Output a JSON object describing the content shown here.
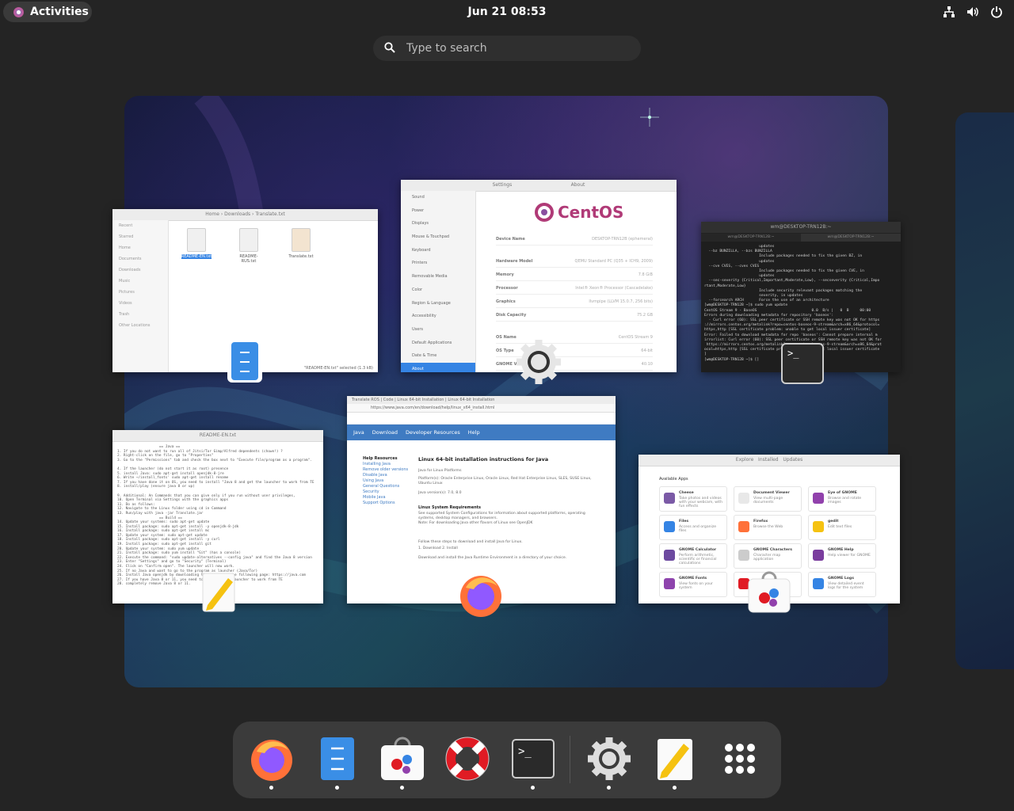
{
  "topbar": {
    "activities_label": "Activities",
    "clock": "Jun 21  08:53",
    "tray_icons": [
      "network-wired-icon",
      "volume-icon",
      "power-icon"
    ]
  },
  "search": {
    "placeholder": "Type to search"
  },
  "windows": {
    "files": {
      "sidebar": [
        "Recent",
        "Starred",
        "Home",
        "Documents",
        "Downloads",
        "Music",
        "Pictures",
        "Videos",
        "Trash",
        "Other Locations"
      ],
      "files": [
        "README-EN.txt",
        "README-RUS.txt",
        "Translate.txt"
      ],
      "breadcrumbs": [
        "Home",
        "Downloads",
        "Translate.txt"
      ],
      "status": "\"README-EN.txt\" selected (1.3 kB)"
    },
    "settings": {
      "title": "Settings",
      "panel_title": "About",
      "sidebar": [
        "Sound",
        "Power",
        "Displays",
        "Mouse & Touchpad",
        "Keyboard",
        "Printers",
        "Removable Media",
        "Color",
        "Region & Language",
        "Accessibility",
        "Users",
        "Default Applications",
        "Date & Time",
        "About"
      ],
      "logo_text": "CentOS",
      "rows": [
        {
          "label": "Device Name",
          "value": "DESKTOP-TRN12B (ephemeral)"
        },
        {
          "label": "Hardware Model",
          "value": "QEMU Standard PC (Q35 + ICH9, 2009)"
        },
        {
          "label": "Memory",
          "value": "7.8 GiB"
        },
        {
          "label": "Processor",
          "value": "Intel® Xeon® Processor (Cascadelake)"
        },
        {
          "label": "Graphics",
          "value": "llvmpipe (LLVM 15.0.7, 256 bits)"
        },
        {
          "label": "Disk Capacity",
          "value": "75.2 GB"
        },
        {
          "label": "OS Name",
          "value": "CentOS Stream 9"
        },
        {
          "label": "OS Type",
          "value": "64-bit"
        },
        {
          "label": "GNOME Version",
          "value": "40.10"
        }
      ]
    },
    "terminal": {
      "title": "wm@DESKTOP-TRN12B:~",
      "tabs": [
        "wm@DESKTOP-TRN12B:~",
        "wm@DESKTOP-TRN12B:~"
      ],
      "lines": [
        "                         updates",
        "  --bz BUNZILLA, --bzs BUNZILLA",
        "                         Include packages needed to fix the given BZ, in",
        "                         updates",
        "  --cve CVES, --cves CVES",
        "                         Include packages needed to fix the given CVE, in",
        "                         updates",
        "  --sec-severity {Critical,Important,Moderate,Low}, --secseverity {Critical,Impo",
        "rtant,Moderate,Low}",
        "                         Include security relevant packages matching the",
        "                         severity, in updates",
        "  --forcearch ARCH       Force the use of an architecture",
        "[wm@DESKTOP-TRN12B ~]$ sudo yum update",
        "CentOS Stream 9 - BaseOS                         0.0  B/s |   0  B     00:00",
        "Errors during downloading metadata for repository 'baseos':",
        "  - Curl error (60): SSL peer certificate or SSH remote key was not OK for https",
        "://mirrors.centos.org/metalink?repo=centos-baseos-9-stream&arch=x86_64&protocol=",
        "https,http [SSL certificate problem: unable to get local issuer certificate]",
        "Error: Failed to download metadata for repo 'baseos': Cannot prepare internal m",
        "irrorlist: Curl error (60): SSL peer certificate or SSH remote key was not OK for",
        " https://mirrors.centos.org/metalink?repo=centos-baseos-9-stream&arch=x86_64&prot",
        "ocol=https,http [SSL certificate problem: unable to get local issuer certificate",
        "]",
        "[wm@DESKTOP-TRN12B ~]$ []"
      ]
    },
    "editor": {
      "title": "README-EN.txt",
      "lines": [
        "                    == Java ==",
        "1. If you do not want to run all of Jitsi/Tor Gimp/Alfred dependents (chown!) ?",
        "2. Right-click on the file, go to \"Properties\"",
        "3. Go to the \"Permissions\" tab and check the box next to \"Execute file/program as a program\".",
        "",
        "4. If the launcher (do not start it as root) presence",
        "5. install Java: sudo apt-get install openjdk-8-jre",
        "6. Write ~/install_fonts' sudo apt-get install rename",
        "7. If you have done it on OS, you need to install \"Java 8 and get the launcher to work from TE",
        "8. install/play (ensure java 8 or up)",
        "",
        "9. Additional: An Commands that you can give only if you run without user privileges,",
        "10. Open Terminal via Settings with the graphics apps",
        "11. Do as follows:",
        "12. Navigate to the Linux folder using cd in Command",
        "13. Run/play with java -jar Translate.jar",
        "                    == Build ==",
        "14. Update your systems: sudo apt-get update",
        "15. Install package: sudo apt-get install -y openjdk-8-jdk",
        "16. Install package: sudo apt-get install mc",
        "17. Update your system: sudo apt-get update",
        "18. Install package: sudo apt-get install -y curl",
        "19. Install package: sudo apt-get install git",
        "20. Update your system: sudo yum update",
        "21. Install package: sudo yum install \"Git\" (has a console)",
        "22. Execute the command: \"sudo update-alternatives --config java\" and find the Java 8 version",
        "23. Enter \"Settings\" and go to \"Security\" (Terminal)",
        "24. Click on \"Confirm open\". The launcher will now work.",
        "25. If no Java and want to go to the program as launcher (Java/Tor)",
        "26. Install Java openjdk by downloading the file from the following page: https://java.com",
        "27. If you have Java 8 or 11, you need to download the launcher to work from TE",
        "28. completely remove Java 8 or 11."
      ]
    },
    "browser": {
      "tabs": [
        "Translate ROS | Code",
        "Linux 64-bit Installation",
        "Linux 64-bit Installation"
      ],
      "url": "https://www.java.com/en/download/help/linux_x64_install.html",
      "nav": [
        "Java",
        "Download",
        "Developer Resources",
        "Help"
      ],
      "heading": "Linux 64-bit installation instructions for Java",
      "side_title": "Help Resources",
      "side_links": [
        "Installing Java",
        "Remove older versions",
        "Disable Java",
        "Using Java",
        "General Questions",
        "Security",
        "Mobile Java",
        "Support Options"
      ],
      "subheading": "Linux System Requirements",
      "paragraphs": [
        "Java for Linux Platforms",
        "Platform(s): Oracle Enterprise Linux, Oracle Linux, Red Hat Enterprise Linux, SLES, SUSE Linux, Ubuntu Linux",
        "Java version(s): 7.0, 8.0",
        "See supported System Configurations for information about supported platforms, operating systems, desktop managers, and browsers.",
        "Note: For downloading Java other flavors of Linux see OpenJDK",
        "Follow these steps to download and install Java for Linux.",
        "1. Download  2. Install",
        "Download and install the Java Runtime Environment in a directory of your choice."
      ]
    },
    "software": {
      "tabs": [
        "Explore",
        "Installed",
        "Updates"
      ],
      "section": "Available Apps",
      "apps": [
        {
          "name": "Cheese",
          "desc": "Take photos and videos with your webcam, with fun effects"
        },
        {
          "name": "Document Viewer",
          "desc": "View multi-page documents"
        },
        {
          "name": "Eye of GNOME",
          "desc": "Browse and rotate images"
        },
        {
          "name": "Files",
          "desc": "Access and organize files"
        },
        {
          "name": "Firefox",
          "desc": "Browse the Web"
        },
        {
          "name": "gedit",
          "desc": "Edit text files"
        },
        {
          "name": "GNOME Calculator",
          "desc": "Perform arithmetic, scientific or financial calculations"
        },
        {
          "name": "GNOME Characters",
          "desc": "Character map application"
        },
        {
          "name": "GNOME Help",
          "desc": "Help viewer for GNOME"
        },
        {
          "name": "GNOME Fonts",
          "desc": "View fonts on your system"
        },
        {
          "name": "",
          "desc": ""
        },
        {
          "name": "GNOME Logs",
          "desc": "View detailed event logs for the system"
        }
      ]
    }
  },
  "dock": {
    "items": [
      {
        "name": "firefox",
        "running": true
      },
      {
        "name": "files",
        "running": true
      },
      {
        "name": "software",
        "running": true
      },
      {
        "name": "help",
        "running": false
      },
      {
        "name": "terminal",
        "running": true
      },
      {
        "name": "settings",
        "running": true
      },
      {
        "name": "text-editor",
        "running": true
      },
      {
        "name": "show-apps",
        "running": false
      }
    ]
  },
  "colors": {
    "panel_bg": "#242424",
    "dock_bg": "#3b3b3b",
    "accent": "#3584e4",
    "centos_purple": "#b03a77"
  }
}
